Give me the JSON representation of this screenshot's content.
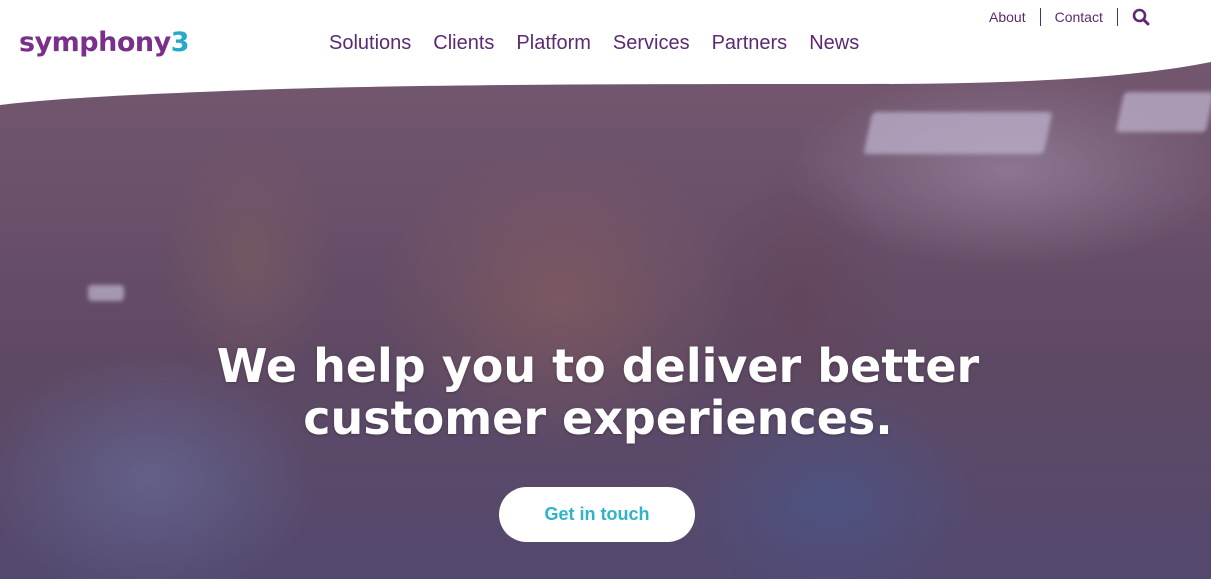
{
  "brand": {
    "name_text": "symphony",
    "name_digit": "3",
    "primary_color": "#7a2f8a",
    "accent_color": "#27a9c9"
  },
  "top_nav": {
    "items": [
      {
        "label": "About"
      },
      {
        "label": "Contact"
      }
    ],
    "search_icon": "search-icon"
  },
  "main_nav": {
    "items": [
      {
        "label": "Solutions"
      },
      {
        "label": "Clients"
      },
      {
        "label": "Platform"
      },
      {
        "label": "Services"
      },
      {
        "label": "Partners"
      },
      {
        "label": "News"
      }
    ]
  },
  "hero": {
    "headline_line1": "We help you to deliver better",
    "headline_line2": "customer experiences.",
    "cta_label": "Get in touch",
    "cta_text_color": "#2eb3c9"
  }
}
